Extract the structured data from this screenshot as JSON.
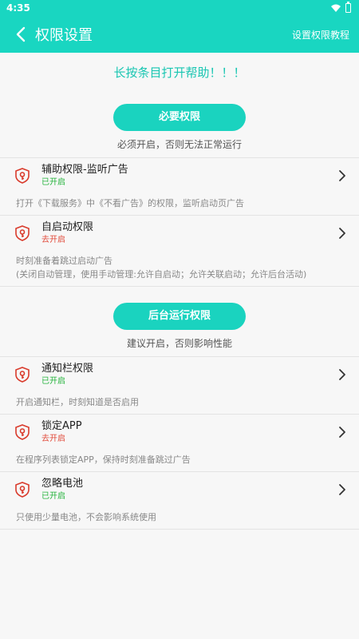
{
  "status_bar": {
    "time": "4:35"
  },
  "header": {
    "title": "权限设置",
    "tutorial_link": "设置权限教程"
  },
  "hint": "长按条目打开帮助！！！",
  "section_required": {
    "button": "必要权限",
    "subtitle": "必须开启，否则无法正常运行",
    "items": [
      {
        "title": "辅助权限-监听广告",
        "status": "已开启",
        "desc": "打开《下载服务》中《不看广告》的权限，监听启动页广告"
      },
      {
        "title": "自启动权限",
        "status": "去开启",
        "desc": "时刻准备着跳过启动广告",
        "desc2": "(关闭自动管理，使用手动管理:允许自启动；允许关联启动；允许后台活动)"
      }
    ]
  },
  "section_background": {
    "button": "后台运行权限",
    "subtitle": "建议开启，否则影响性能",
    "items": [
      {
        "title": "通知栏权限",
        "status": "已开启",
        "desc": "开启通知栏，时刻知道是否启用"
      },
      {
        "title": "锁定APP",
        "status": "去开启",
        "desc": "在程序列表锁定APP，保持时刻准备跳过广告"
      },
      {
        "title": "忽略电池",
        "status": "已开启",
        "desc": "只使用少量电池，不会影响系统使用"
      }
    ]
  },
  "colors": {
    "accent": "#19d6c1",
    "enabled": "#25b33c",
    "disabled": "#e14a3a",
    "shield": "#d93a2b"
  },
  "icons": {
    "back": "chevron-left-icon",
    "item": "shield-key-icon",
    "arrow": "chevron-right-icon"
  }
}
